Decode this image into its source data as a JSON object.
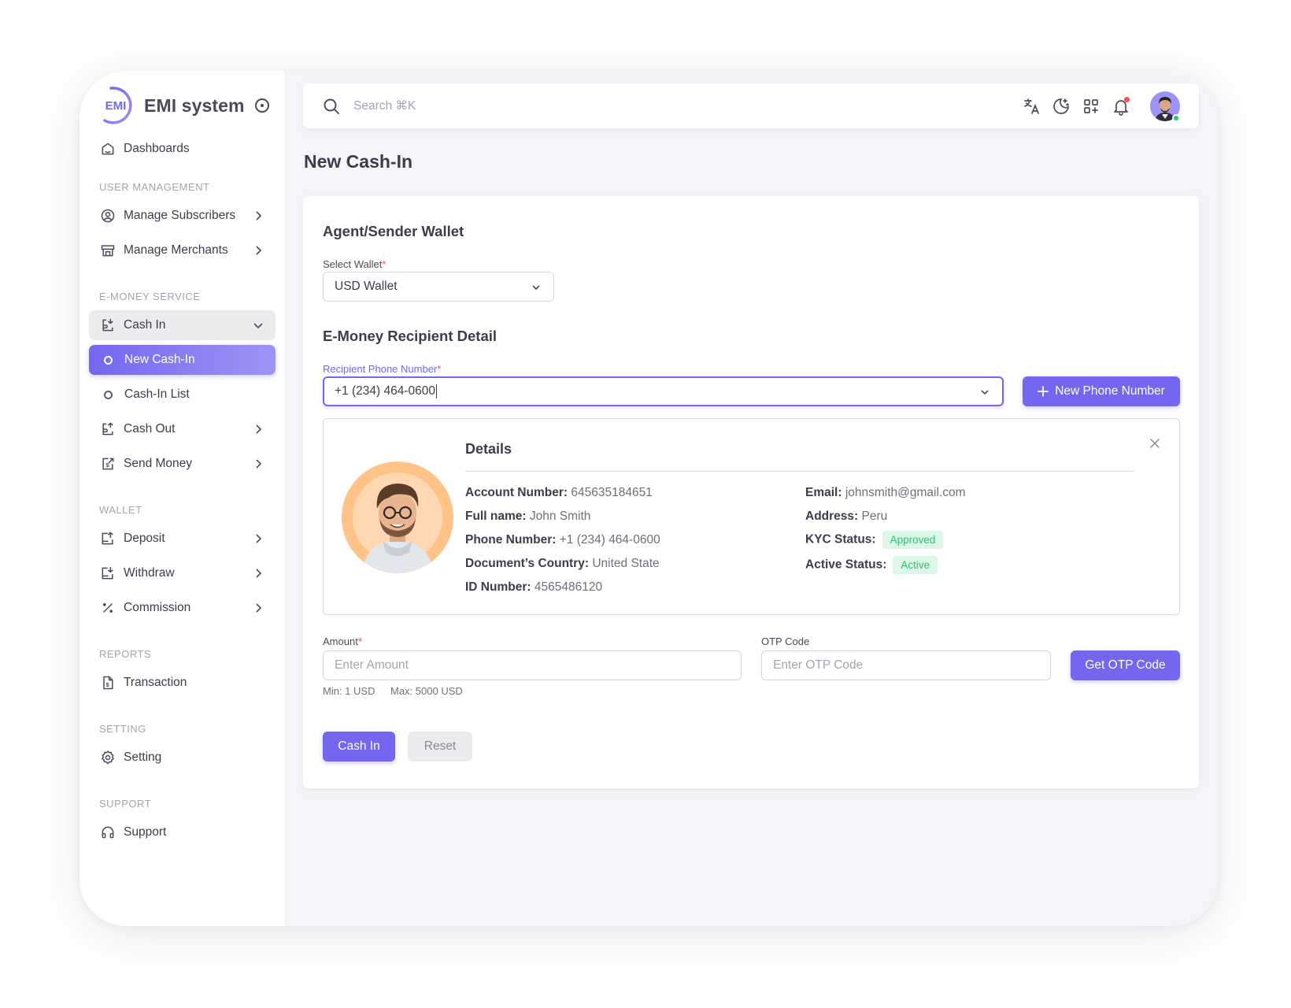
{
  "app": {
    "name": "EMI system",
    "logo_text": "EMI"
  },
  "sidebar": {
    "dashboards": "Dashboards",
    "sections": {
      "user_management": "USER MANAGEMENT",
      "e_money_service": "E-MONEY SERVICE",
      "wallet": "WALLET",
      "reports": "REPORTS",
      "setting": "SETTING",
      "support": "SUPPORT"
    },
    "items": {
      "manage_subscribers": "Manage Subscribers",
      "manage_merchants": "Manage Merchants",
      "cash_in": "Cash In",
      "new_cash_in": "New Cash-In",
      "cash_in_list": "Cash-In List",
      "cash_out": "Cash Out",
      "send_money": "Send Money",
      "deposit": "Deposit",
      "withdraw": "Withdraw",
      "commission": "Commission",
      "transaction": "Transaction",
      "setting": "Setting",
      "support": "Support"
    }
  },
  "topbar": {
    "search_placeholder": "Search ⌘K",
    "icons": [
      "translate-icon",
      "moon-icon",
      "apps-add-icon",
      "bell-icon",
      "user-avatar"
    ],
    "has_notification": true,
    "user_online": true
  },
  "page": {
    "title": "New Cash-In"
  },
  "form": {
    "sender_heading": "Agent/Sender Wallet",
    "select_wallet_label": "Select Wallet",
    "select_wallet_value": "USD Wallet",
    "recipient_heading": "E-Money Recipient Detail",
    "recipient_phone_label": "Recipient Phone Number",
    "recipient_phone_value": "+1 (234) 464-0600",
    "new_phone_button": "New Phone Number",
    "required_mark": "*",
    "amount_label": "Amount",
    "amount_placeholder": "Enter Amount",
    "amount_min": "Min: 1 USD",
    "amount_max": "Max: 5000 USD",
    "otp_label": "OTP Code",
    "otp_placeholder": "Enter OTP Code",
    "get_otp_button": "Get OTP Code",
    "submit_button": "Cash In",
    "reset_button": "Reset"
  },
  "details": {
    "title": "Details",
    "left": [
      {
        "key": "Account Number:",
        "value": "645635184651"
      },
      {
        "key": "Full name:",
        "value": "John Smith"
      },
      {
        "key": "Phone Number:",
        "value": "+1 (234) 464-0600"
      },
      {
        "key": "Document’s Country:",
        "value": "United State"
      },
      {
        "key": "ID Number:",
        "value": "4565486120"
      }
    ],
    "right": [
      {
        "key": "Email:",
        "value": "johnsmith@gmail.com"
      },
      {
        "key": "Address:",
        "value": "Peru"
      }
    ],
    "kyc_status_label": "KYC Status:",
    "kyc_status": "Approved",
    "active_status_label": "Active Status:",
    "active_status": "Active"
  },
  "colors": {
    "primary": "#7367f0",
    "success": "#28c76f",
    "success_bg": "#dcf6e8",
    "danger": "#ff4c51",
    "text": "#3d3c4a",
    "muted": "#a5a3ae"
  }
}
